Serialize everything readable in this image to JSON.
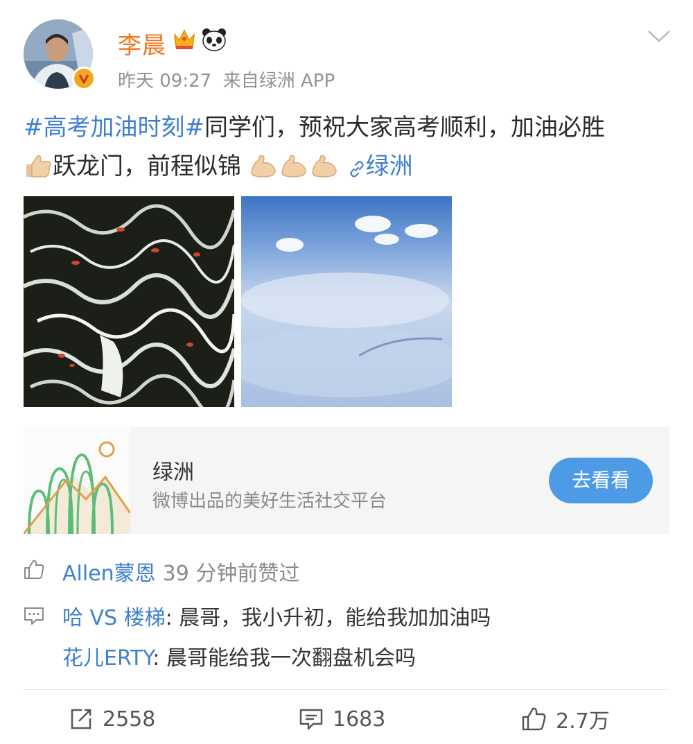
{
  "header": {
    "user_name": "李晨",
    "time": "昨天 09:27",
    "source": "来自绿洲 APP"
  },
  "post": {
    "hashtag": "#高考加油时刻#",
    "text_part1": "同学们，预祝大家高考顺利，加油必胜",
    "text_part2": "跃龙门，前程似锦",
    "link_label": "绿洲"
  },
  "card": {
    "title": "绿洲",
    "subtitle": "微博出品的美好生活社交平台",
    "button_label": "去看看"
  },
  "likes": {
    "user": "Allen蒙恩",
    "when": "39 分钟前赞过"
  },
  "comments": [
    {
      "name": "哈 VS 楼梯",
      "text": ": 晨哥，我小升初，能给我加加油吗"
    },
    {
      "name": "花儿ERTY",
      "text": ": 晨哥能给我一次翻盘机会吗"
    }
  ],
  "actions": {
    "repost_count": "2558",
    "comment_count": "1683",
    "like_count": "2.7万"
  },
  "colors": {
    "name": "#f5741b",
    "link": "#3f7fcd",
    "button": "#4d9be6",
    "meta": "#939393"
  }
}
